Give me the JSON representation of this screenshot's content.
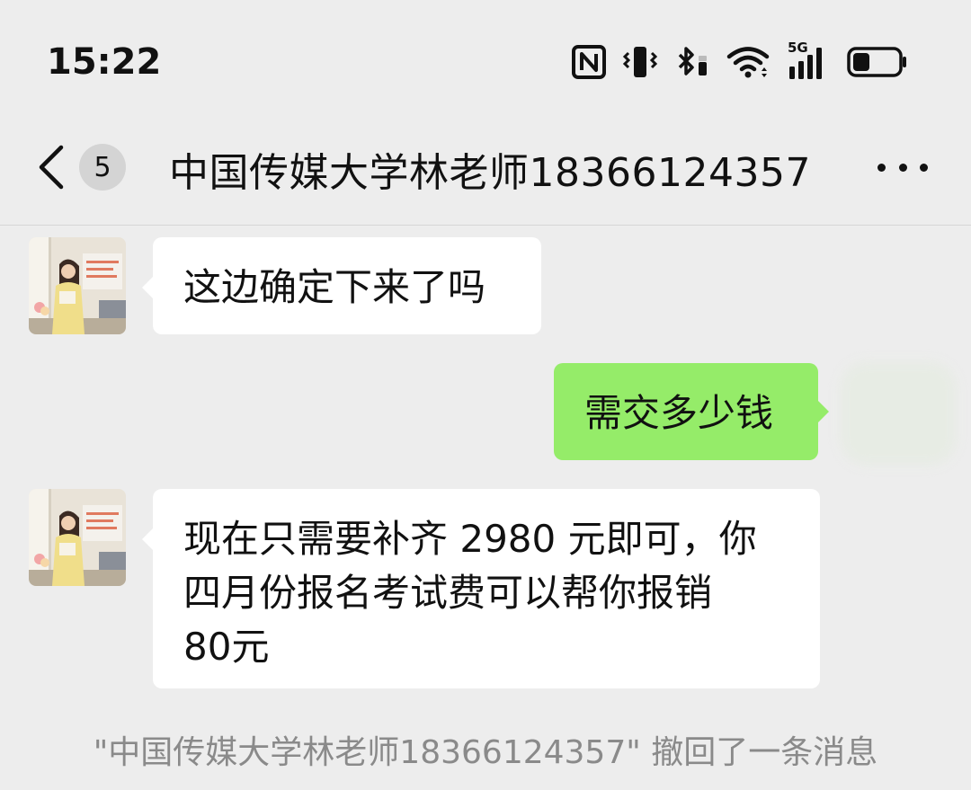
{
  "status_bar": {
    "time": "15:22",
    "network_label": "5G",
    "icons": [
      "nfc-icon",
      "vibrate-icon",
      "bluetooth-icon",
      "wifi-icon",
      "cellular-5g-icon",
      "battery-icon"
    ]
  },
  "header": {
    "back_icon": "chevron-left-icon",
    "unread_count": "5",
    "title": "中国传媒大学林老师18366124357",
    "more_icon": "more-dots-icon"
  },
  "messages": [
    {
      "side": "left",
      "text": "这边确定下来了吗"
    },
    {
      "side": "right",
      "text": "需交多少钱"
    },
    {
      "side": "left",
      "lines": [
        "现在只需要补齐 2980 元即可，你",
        "四月份报名考试费可以帮你报销",
        "80元"
      ]
    }
  ],
  "system_notice": "\"中国传媒大学林老师18366124357\" 撤回了一条消息",
  "colors": {
    "background": "#ededed",
    "incoming_bubble": "#ffffff",
    "outgoing_bubble": "#95ec69",
    "notice_text": "#8a8a8a"
  }
}
